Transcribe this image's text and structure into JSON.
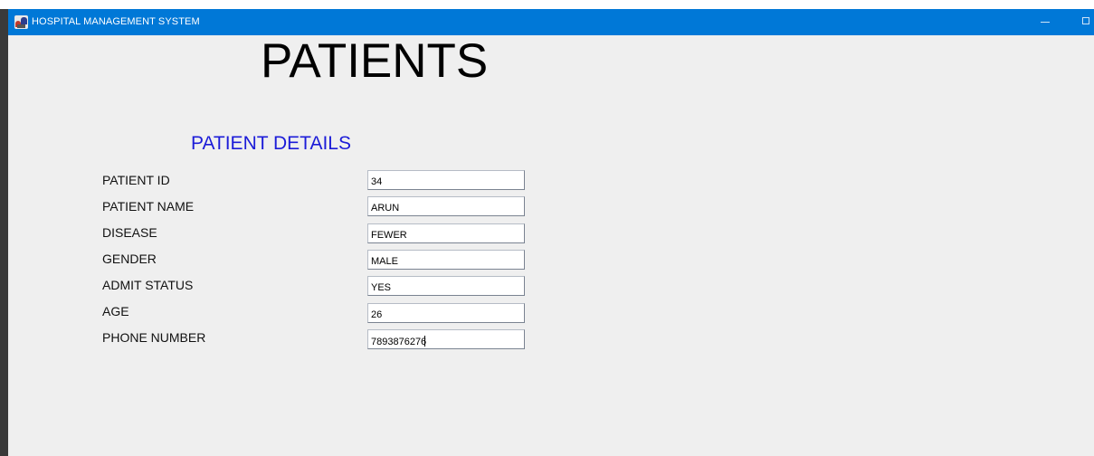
{
  "window": {
    "title": "HOSPITAL MANAGEMENT SYSTEM",
    "icon": "hospital-app-icon",
    "accent_color": "#0078d7"
  },
  "page": {
    "title": "PATIENTS",
    "section_title": "PATIENT DETAILS",
    "section_color": "#1c1cd8"
  },
  "fields": [
    {
      "label": "PATIENT ID",
      "value": "34"
    },
    {
      "label": "PATIENT NAME",
      "value": "ARUN"
    },
    {
      "label": "DISEASE",
      "value": "FEWER"
    },
    {
      "label": "GENDER",
      "value": "MALE"
    },
    {
      "label": "ADMIT STATUS",
      "value": "YES"
    },
    {
      "label": "AGE",
      "value": "26"
    },
    {
      "label": "PHONE NUMBER",
      "value": "7893876276"
    }
  ]
}
